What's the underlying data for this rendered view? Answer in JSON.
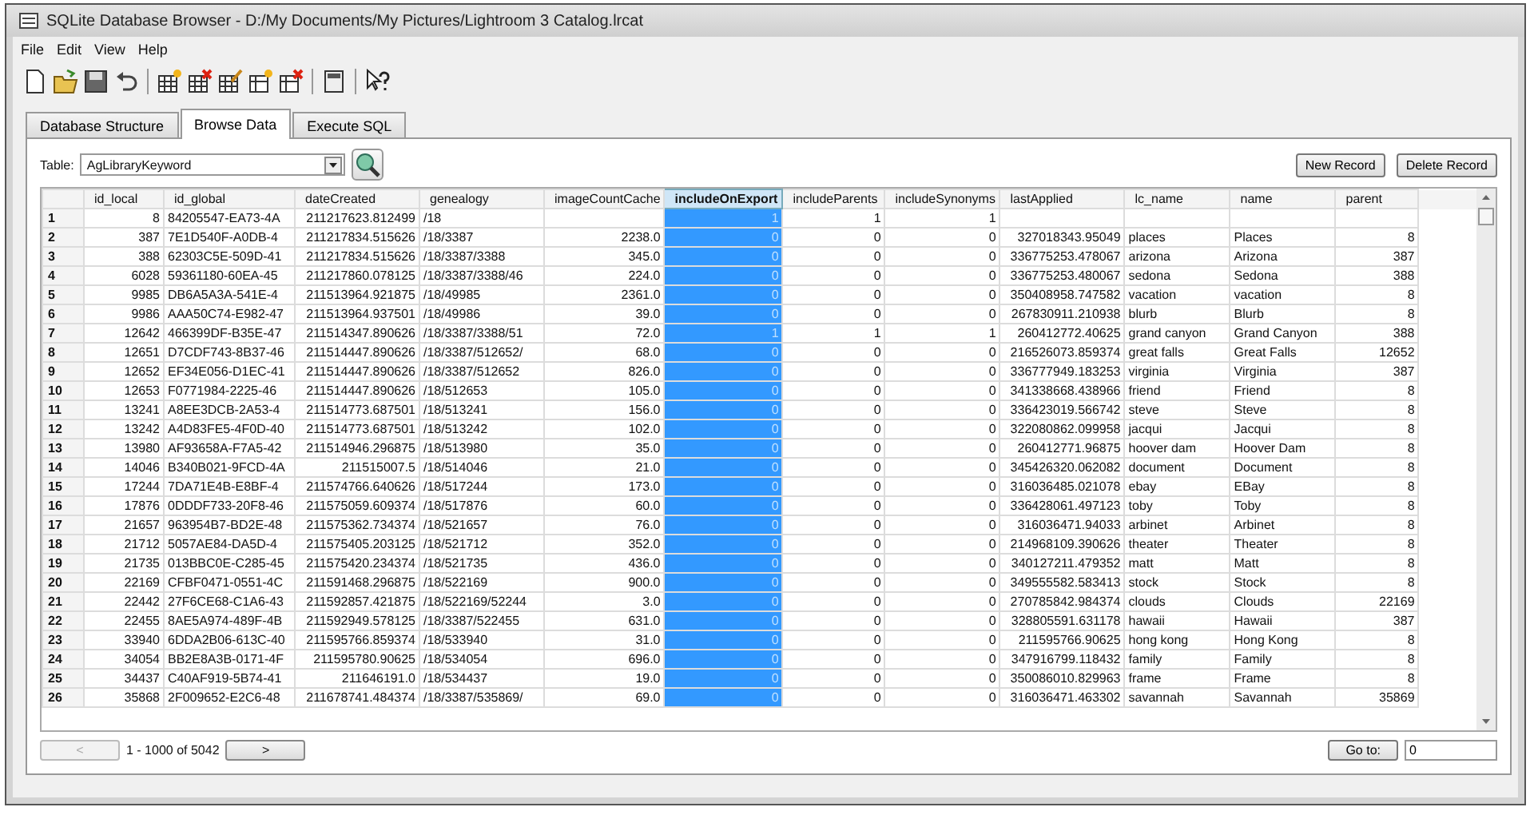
{
  "window": {
    "title": "SQLite Database Browser - D:/My Documents/My Pictures/Lightroom 3 Catalog.lrcat"
  },
  "menu": [
    "File",
    "Edit",
    "View",
    "Help"
  ],
  "tabs": [
    {
      "label": "Database Structure",
      "selected": false
    },
    {
      "label": "Browse Data",
      "selected": true
    },
    {
      "label": "Execute SQL",
      "selected": false
    }
  ],
  "table_picker": {
    "label": "Table:",
    "value": "AgLibraryKeyword"
  },
  "buttons": [
    "New Record",
    "Delete Record"
  ],
  "table": {
    "columns": [
      {
        "label": "id_local",
        "kind": "numeric",
        "selected": false
      },
      {
        "label": "id_global",
        "kind": "text",
        "selected": false
      },
      {
        "label": "dateCreated",
        "kind": "numeric",
        "selected": false
      },
      {
        "label": "genealogy",
        "kind": "text",
        "selected": false
      },
      {
        "label": "imageCountCache",
        "kind": "numeric",
        "selected": false
      },
      {
        "label": "includeOnExport",
        "kind": "numeric",
        "selected": true
      },
      {
        "label": "includeParents",
        "kind": "numeric",
        "selected": false
      },
      {
        "label": "includeSynonyms",
        "kind": "numeric",
        "selected": false
      },
      {
        "label": "lastApplied",
        "kind": "numeric",
        "selected": false
      },
      {
        "label": "lc_name",
        "kind": "text",
        "selected": false
      },
      {
        "label": "name",
        "kind": "text",
        "selected": false
      },
      {
        "label": "parent",
        "kind": "numeric",
        "selected": false
      }
    ],
    "rows": [
      {
        "number": "1",
        "cells": [
          "8",
          "84205547-EA73-4A",
          "211217623.812499",
          "/18",
          null,
          "1",
          "1",
          "1",
          null,
          null,
          null,
          null
        ]
      },
      {
        "number": "2",
        "cells": [
          "387",
          "7E1D540F-A0DB-4",
          "211217834.515626",
          "/18/3387",
          "2238.0",
          "0",
          "0",
          "0",
          "327018343.95049",
          "places",
          "Places",
          "8"
        ]
      },
      {
        "number": "3",
        "cells": [
          "388",
          "62303C5E-509D-41",
          "211217834.515626",
          "/18/3387/3388",
          "345.0",
          "0",
          "0",
          "0",
          "336775253.478067",
          "arizona",
          "Arizona",
          "387"
        ]
      },
      {
        "number": "4",
        "cells": [
          "6028",
          "59361180-60EA-45",
          "211217860.078125",
          "/18/3387/3388/46",
          "224.0",
          "0",
          "0",
          "0",
          "336775253.480067",
          "sedona",
          "Sedona",
          "388"
        ]
      },
      {
        "number": "5",
        "cells": [
          "9985",
          "DB6A5A3A-541E-4",
          "211513964.921875",
          "/18/49985",
          "2361.0",
          "0",
          "0",
          "0",
          "350408958.747582",
          "vacation",
          "vacation",
          "8"
        ]
      },
      {
        "number": "6",
        "cells": [
          "9986",
          "AAA50C74-E982-47",
          "211513964.937501",
          "/18/49986",
          "39.0",
          "0",
          "0",
          "0",
          "267830911.210938",
          "blurb",
          "Blurb",
          "8"
        ]
      },
      {
        "number": "7",
        "cells": [
          "12642",
          "466399DF-B35E-47",
          "211514347.890626",
          "/18/3387/3388/51",
          "72.0",
          "1",
          "1",
          "1",
          "260412772.40625",
          "grand canyon",
          "Grand Canyon",
          "388"
        ]
      },
      {
        "number": "8",
        "cells": [
          "12651",
          "D7CDF743-8B37-46",
          "211514447.890626",
          "/18/3387/512652/",
          "68.0",
          "0",
          "0",
          "0",
          "216526073.859374",
          "great falls",
          "Great Falls",
          "12652"
        ]
      },
      {
        "number": "9",
        "cells": [
          "12652",
          "EF34E056-D1EC-41",
          "211514447.890626",
          "/18/3387/512652",
          "826.0",
          "0",
          "0",
          "0",
          "336777949.183253",
          "virginia",
          "Virginia",
          "387"
        ]
      },
      {
        "number": "10",
        "cells": [
          "12653",
          "F0771984-2225-46",
          "211514447.890626",
          "/18/512653",
          "105.0",
          "0",
          "0",
          "0",
          "341338668.438966",
          "friend",
          "Friend",
          "8"
        ]
      },
      {
        "number": "11",
        "cells": [
          "13241",
          "A8EE3DCB-2A53-4",
          "211514773.687501",
          "/18/513241",
          "156.0",
          "0",
          "0",
          "0",
          "336423019.566742",
          "steve",
          "Steve",
          "8"
        ]
      },
      {
        "number": "12",
        "cells": [
          "13242",
          "A4D83FE5-4F0D-40",
          "211514773.687501",
          "/18/513242",
          "102.0",
          "0",
          "0",
          "0",
          "322080862.099958",
          "jacqui",
          "Jacqui",
          "8"
        ]
      },
      {
        "number": "13",
        "cells": [
          "13980",
          "AF93658A-F7A5-42",
          "211514946.296875",
          "/18/513980",
          "35.0",
          "0",
          "0",
          "0",
          "260412771.96875",
          "hoover dam",
          "Hoover Dam",
          "8"
        ]
      },
      {
        "number": "14",
        "cells": [
          "14046",
          "B340B021-9FCD-4A",
          "211515007.5",
          "/18/514046",
          "21.0",
          "0",
          "0",
          "0",
          "345426320.062082",
          "document",
          "Document",
          "8"
        ]
      },
      {
        "number": "15",
        "cells": [
          "17244",
          "7DA71E4B-E8BF-4",
          "211574766.640626",
          "/18/517244",
          "173.0",
          "0",
          "0",
          "0",
          "316036485.021078",
          "ebay",
          "EBay",
          "8"
        ]
      },
      {
        "number": "16",
        "cells": [
          "17876",
          "0DDDF733-20F8-46",
          "211575059.609374",
          "/18/517876",
          "60.0",
          "0",
          "0",
          "0",
          "336428061.497123",
          "toby",
          "Toby",
          "8"
        ]
      },
      {
        "number": "17",
        "cells": [
          "21657",
          "963954B7-BD2E-48",
          "211575362.734374",
          "/18/521657",
          "76.0",
          "0",
          "0",
          "0",
          "316036471.94033",
          "arbinet",
          "Arbinet",
          "8"
        ]
      },
      {
        "number": "18",
        "cells": [
          "21712",
          "5057AE84-DA5D-4",
          "211575405.203125",
          "/18/521712",
          "352.0",
          "0",
          "0",
          "0",
          "214968109.390626",
          "theater",
          "Theater",
          "8"
        ]
      },
      {
        "number": "19",
        "cells": [
          "21735",
          "013BBC0E-C285-45",
          "211575420.234374",
          "/18/521735",
          "436.0",
          "0",
          "0",
          "0",
          "340127211.479352",
          "matt",
          "Matt",
          "8"
        ]
      },
      {
        "number": "20",
        "cells": [
          "22169",
          "CFBF0471-0551-4C",
          "211591468.296875",
          "/18/522169",
          "900.0",
          "0",
          "0",
          "0",
          "349555582.583413",
          "stock",
          "Stock",
          "8"
        ]
      },
      {
        "number": "21",
        "cells": [
          "22442",
          "27F6CE68-C1A6-43",
          "211592857.421875",
          "/18/522169/52244",
          "3.0",
          "0",
          "0",
          "0",
          "270785842.984374",
          "clouds",
          "Clouds",
          "22169"
        ]
      },
      {
        "number": "22",
        "cells": [
          "22455",
          "8AE5A974-489F-4B",
          "211592949.578125",
          "/18/3387/522455",
          "631.0",
          "0",
          "0",
          "0",
          "328805591.631178",
          "hawaii",
          "Hawaii",
          "387"
        ]
      },
      {
        "number": "23",
        "cells": [
          "33940",
          "6DDA2B06-613C-40",
          "211595766.859374",
          "/18/533940",
          "31.0",
          "0",
          "0",
          "0",
          "211595766.90625",
          "hong kong",
          "Hong Kong",
          "8"
        ]
      },
      {
        "number": "24",
        "cells": [
          "34054",
          "BB2E8A3B-0171-4F",
          "211595780.90625",
          "/18/534054",
          "696.0",
          "0",
          "0",
          "0",
          "347916799.118432",
          "family",
          "Family",
          "8"
        ]
      },
      {
        "number": "25",
        "cells": [
          "34437",
          "C40AF919-5B74-41",
          "211646191.0",
          "/18/534437",
          "19.0",
          "0",
          "0",
          "0",
          "350086010.829963",
          "frame",
          "Frame",
          "8"
        ]
      },
      {
        "number": "26",
        "cells": [
          "35868",
          "2F009652-E2C6-48",
          "211678741.484374",
          "/18/3387/535869/",
          "69.0",
          "0",
          "0",
          "0",
          "316036471.463302",
          "savannah",
          "Savannah",
          "35869"
        ]
      }
    ]
  },
  "pager": {
    "previous": {
      "label": "<",
      "disabled": true
    },
    "range": "1 - 1000 of 5042",
    "next": {
      "label": ">",
      "disabled": false
    },
    "goto_button": "Go to:",
    "goto_value": "0"
  }
}
